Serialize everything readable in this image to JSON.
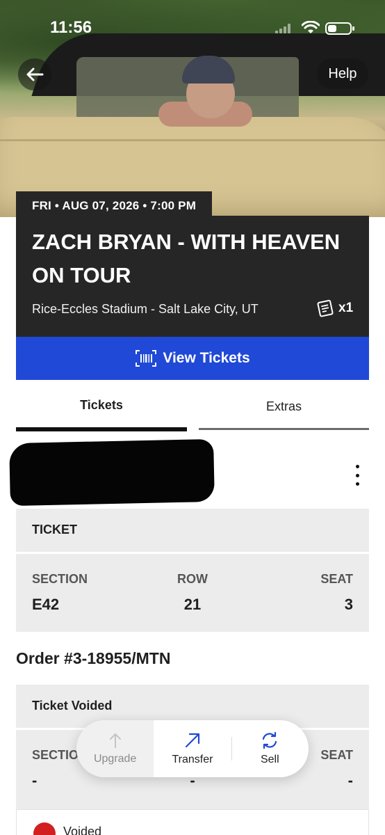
{
  "status_bar": {
    "time": "11:56"
  },
  "nav": {
    "help_label": "Help"
  },
  "event": {
    "date": "FRI • AUG 07, 2026 • 7:00 PM",
    "title": "ZACH BRYAN - WITH HEAVEN ON TOUR",
    "venue": "Rice-Eccles Stadium - Salt Lake City, UT",
    "ticket_count": "x1"
  },
  "view_tickets_label": "View Tickets",
  "tabs": [
    {
      "label": "Tickets",
      "active": true
    },
    {
      "label": "Extras",
      "active": false
    }
  ],
  "ticket_panel": {
    "header": "TICKET",
    "section_label": "SECTION",
    "row_label": "ROW",
    "seat_label": "SEAT",
    "section": "E42",
    "row": "21",
    "seat": "3"
  },
  "order": {
    "number": "Order #3-18955/MTN",
    "status_header": "Ticket Voided",
    "section_label": "SECTION",
    "seat_label": "SEAT",
    "section": "-",
    "row": "-",
    "seat": "-",
    "voided_text": "Voided"
  },
  "actions": [
    {
      "label": "Upgrade",
      "icon": "arrow-up-icon",
      "enabled": false
    },
    {
      "label": "Transfer",
      "icon": "arrow-up-right-icon",
      "enabled": true
    },
    {
      "label": "Sell",
      "icon": "refresh-icon",
      "enabled": true
    }
  ],
  "colors": {
    "brand_blue": "#1f49d6",
    "card_dark": "#262626",
    "voided_red": "#d21f1f"
  }
}
